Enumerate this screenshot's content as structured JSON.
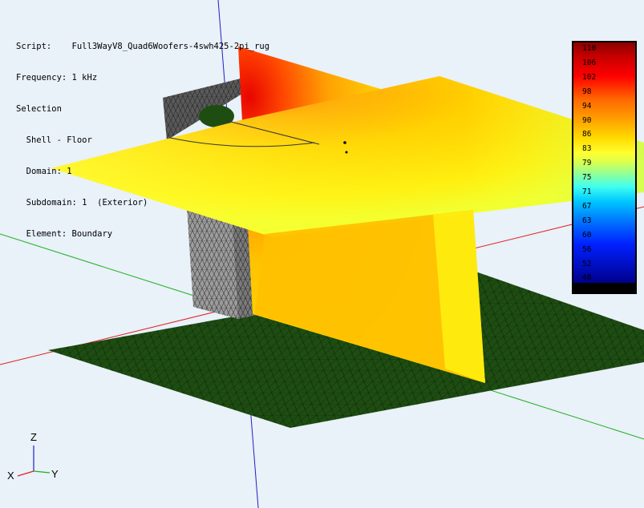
{
  "info": {
    "script_line": "Script:    Full3WayV8_Quad6Woofers-4swh425-2pi_rug",
    "frequency_line": "Frequency: 1 kHz",
    "selection_line": "Selection",
    "shell_line": "  Shell - Floor",
    "domain_line": "  Domain: 1",
    "subdomain_line": "  Subdomain: 1  (Exterior)",
    "element_line": "  Element: Boundary"
  },
  "legend": {
    "ticks": [
      "110",
      "106",
      "102",
      "98",
      "94",
      "90",
      "86",
      "83",
      "79",
      "75",
      "71",
      "67",
      "63",
      "60",
      "56",
      "52",
      "48"
    ]
  },
  "axis_triad": {
    "z_label": "Z",
    "x_label": "X",
    "y_label": "Y"
  },
  "colors": {
    "background": "#e9f1f9",
    "floor": "#1e4d12",
    "axis_red": "#e02020",
    "axis_green": "#20b020",
    "axis_blue": "#2020c0"
  }
}
